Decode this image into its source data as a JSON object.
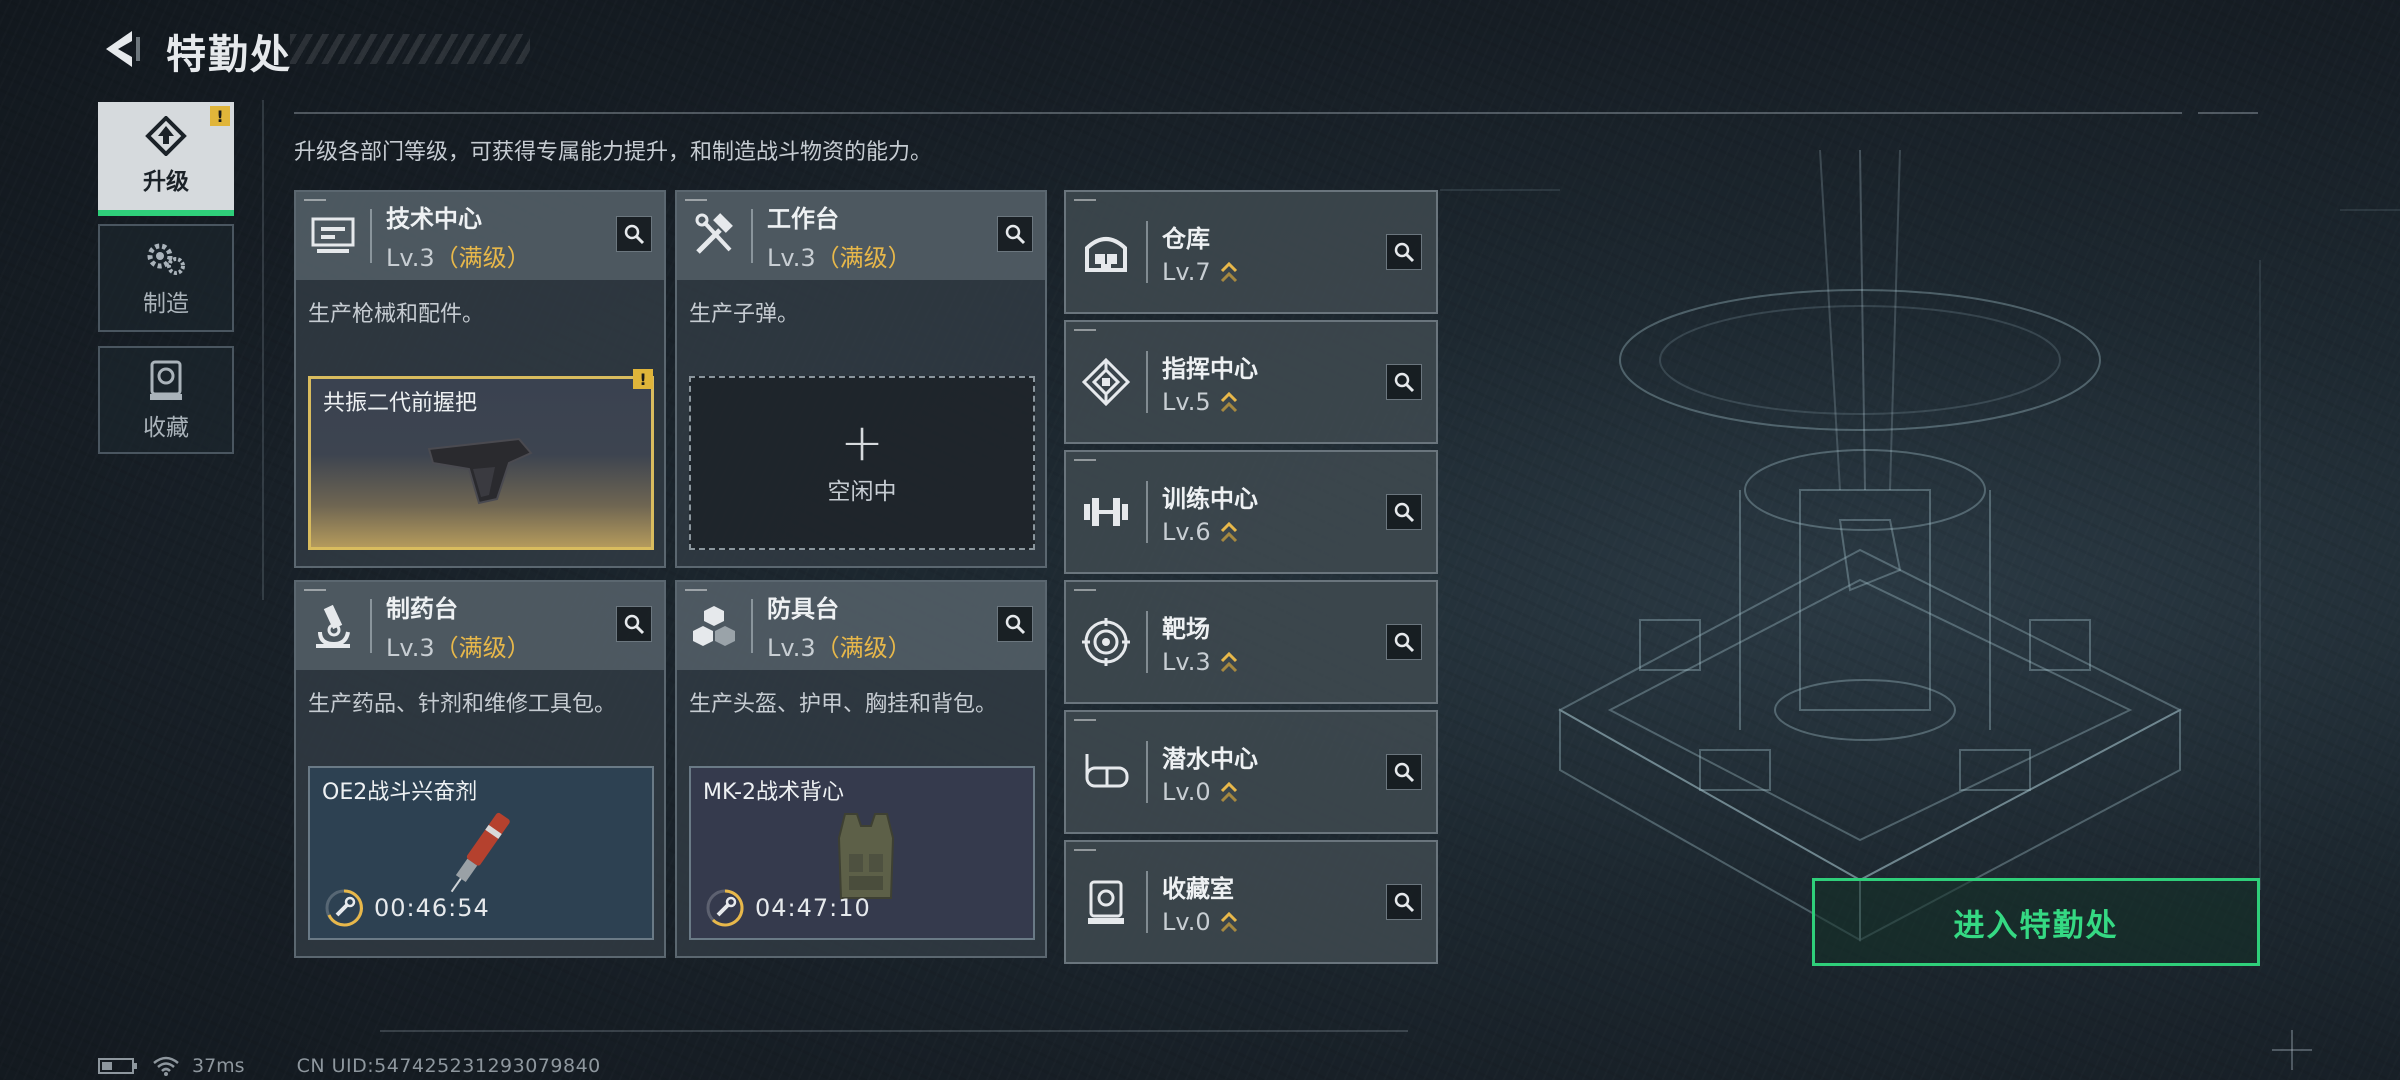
{
  "header": {
    "title": "特勤处"
  },
  "nav": [
    {
      "label": "升级",
      "icon": "upgrade-icon",
      "active": true,
      "badge": "!"
    },
    {
      "label": "制造",
      "icon": "gears-icon",
      "active": false
    },
    {
      "label": "收藏",
      "icon": "collection-icon",
      "active": false
    }
  ],
  "description": "升级各部门等级，可获得专属能力提升，和制造战斗物资的能力。",
  "cards": [
    {
      "name": "技术中心",
      "level": "Lv.3",
      "max": "（满级）",
      "desc": "生产枪械和配件。",
      "icon": "monitor-icon",
      "slot": {
        "type": "item",
        "name": "共振二代前握把",
        "badge": "!"
      }
    },
    {
      "name": "工作台",
      "level": "Lv.3",
      "max": "（满级）",
      "desc": "生产子弹。",
      "icon": "tools-icon",
      "slot": {
        "type": "empty",
        "plus": "+",
        "label": "空闲中"
      }
    },
    {
      "name": "制药台",
      "level": "Lv.3",
      "max": "（满级）",
      "desc": "生产药品、针剂和维修工具包。",
      "icon": "microscope-icon",
      "slot": {
        "type": "craft",
        "name": "OE2战斗兴奋剂",
        "timer": "00:46:54"
      }
    },
    {
      "name": "防具台",
      "level": "Lv.3",
      "max": "（满级）",
      "desc": "生产头盔、护甲、胸挂和背包。",
      "icon": "cubes-icon",
      "slot": {
        "type": "craft",
        "name": "MK-2战术背心",
        "timer": "04:47:10"
      }
    }
  ],
  "facilities": [
    {
      "name": "仓库",
      "level": "Lv.7",
      "icon": "warehouse-icon"
    },
    {
      "name": "指挥中心",
      "level": "Lv.5",
      "icon": "command-icon"
    },
    {
      "name": "训练中心",
      "level": "Lv.6",
      "icon": "dumbbell-icon"
    },
    {
      "name": "靶场",
      "level": "Lv.3",
      "icon": "target-icon"
    },
    {
      "name": "潜水中心",
      "level": "Lv.0",
      "icon": "goggles-icon"
    },
    {
      "name": "收藏室",
      "level": "Lv.0",
      "icon": "showcase-icon"
    }
  ],
  "enter_button": "进入特勤处",
  "status": {
    "ping": "37ms",
    "uid": "CN UID:547425231293079840"
  },
  "colors": {
    "accent_green": "#2fcf7a",
    "max_level_gold": "#e8b84a",
    "badge_yellow": "#e0b53a"
  }
}
